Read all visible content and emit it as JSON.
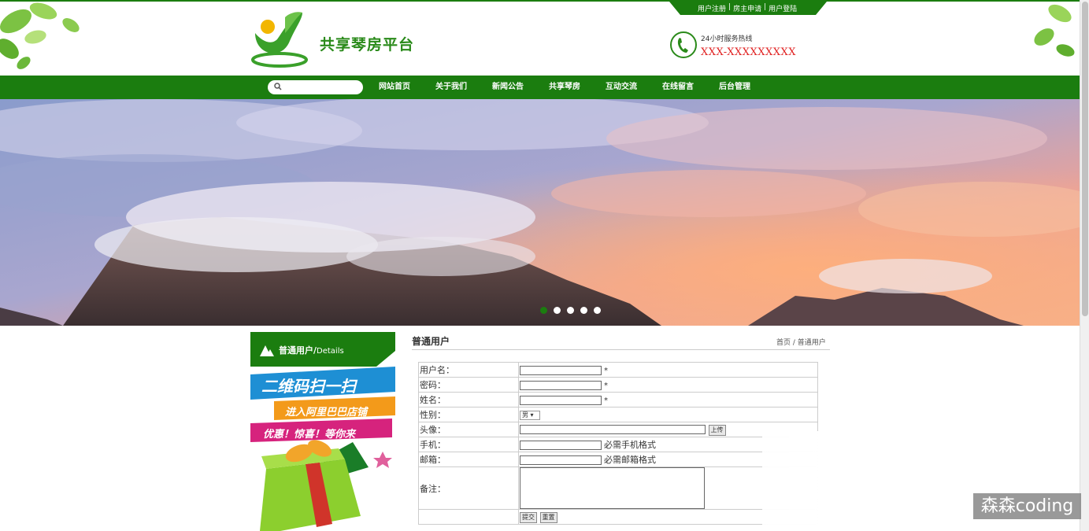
{
  "header": {
    "site_title": "共享琴房平台",
    "top_links": [
      "用户注册",
      "房主申请",
      "用户登陆"
    ],
    "top_sep": "|",
    "hotline_label": "24小时服务热线",
    "hotline_number": "XXX-XXXXXXXXX"
  },
  "nav": {
    "search_value": "",
    "items": [
      "网站首页",
      "关于我们",
      "新闻公告",
      "共享琴房",
      "互动交流",
      "在线留言",
      "后台管理"
    ]
  },
  "banner": {
    "slide_count": 5,
    "active_slide": 1
  },
  "sidebar": {
    "title_cn": "普通用户/",
    "title_en": "Details",
    "promo_line1": "二维码扫一扫",
    "promo_line2": "进入阿里巴巴店铺",
    "promo_line3": "优惠！惊喜！等你来"
  },
  "content": {
    "title": "普通用户",
    "breadcrumb_home": "首页",
    "breadcrumb_sep": " / ",
    "breadcrumb_current": "普通用户"
  },
  "form": {
    "username_label": "用户名：",
    "password_label": "密码：",
    "name_label": "姓名：",
    "gender_label": "性别：",
    "gender_value": "男",
    "avatar_label": "头像：",
    "upload_button": "上传",
    "phone_label": "手机：",
    "phone_hint": "必需手机格式",
    "email_label": "邮箱：",
    "email_hint": "必需邮箱格式",
    "notes_label": "备注：",
    "required_mark": "*",
    "submit_button": "提交",
    "reset_button": "重置"
  },
  "watermark": "森森coding",
  "colors": {
    "brand_green": "#1b7d0f",
    "hotline_red": "#e02020"
  }
}
